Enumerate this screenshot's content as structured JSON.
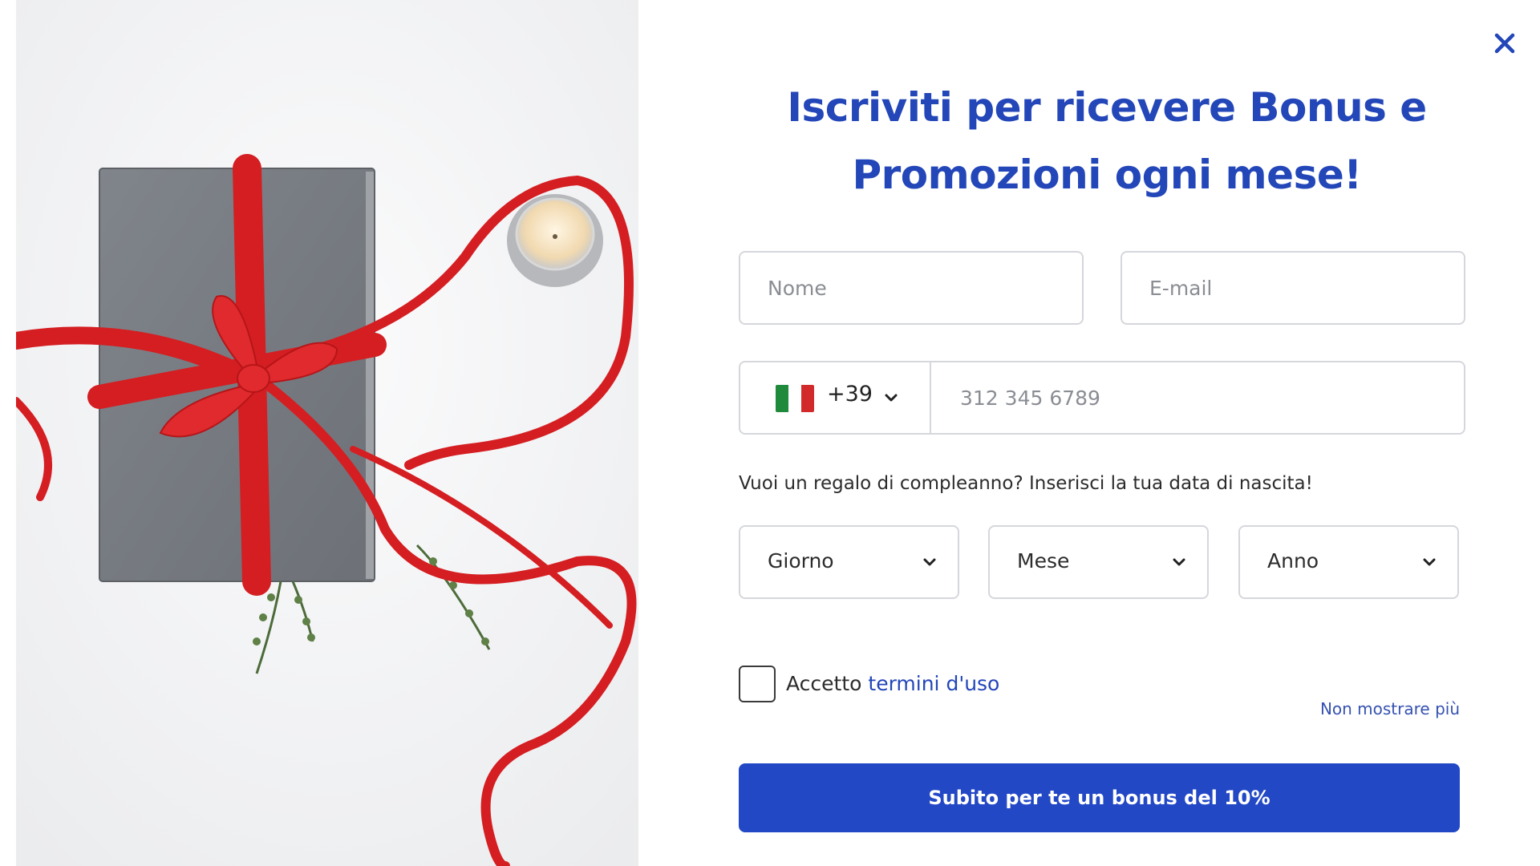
{
  "title": "Iscriviti per ricevere Bonus e Promozioni ogni mese!",
  "close_icon": "close-icon",
  "hero_image": "gift-box-with-red-ribbon-photo",
  "form": {
    "name_placeholder": "Nome",
    "email_placeholder": "E-mail",
    "phone": {
      "country_flag": "italy-flag-icon",
      "flag_colors": [
        "#1f8a3b",
        "#ffffff",
        "#d22a2a"
      ],
      "dial_code": "+39",
      "placeholder": "312 345 6789"
    },
    "birthday_label": "Vuoi un regalo di compleanno? Inserisci la tua data di nascita!",
    "day_select": "Giorno",
    "month_select": "Mese",
    "year_select": "Anno",
    "terms_prefix": "Accetto ",
    "terms_link": "termini d'uso",
    "dont_show": "Non mostrare più",
    "submit_label": "Subito per te un bonus del 10%"
  },
  "colors": {
    "accent": "#2346b8",
    "button": "#2348c6",
    "ribbon": "#d41e22"
  }
}
